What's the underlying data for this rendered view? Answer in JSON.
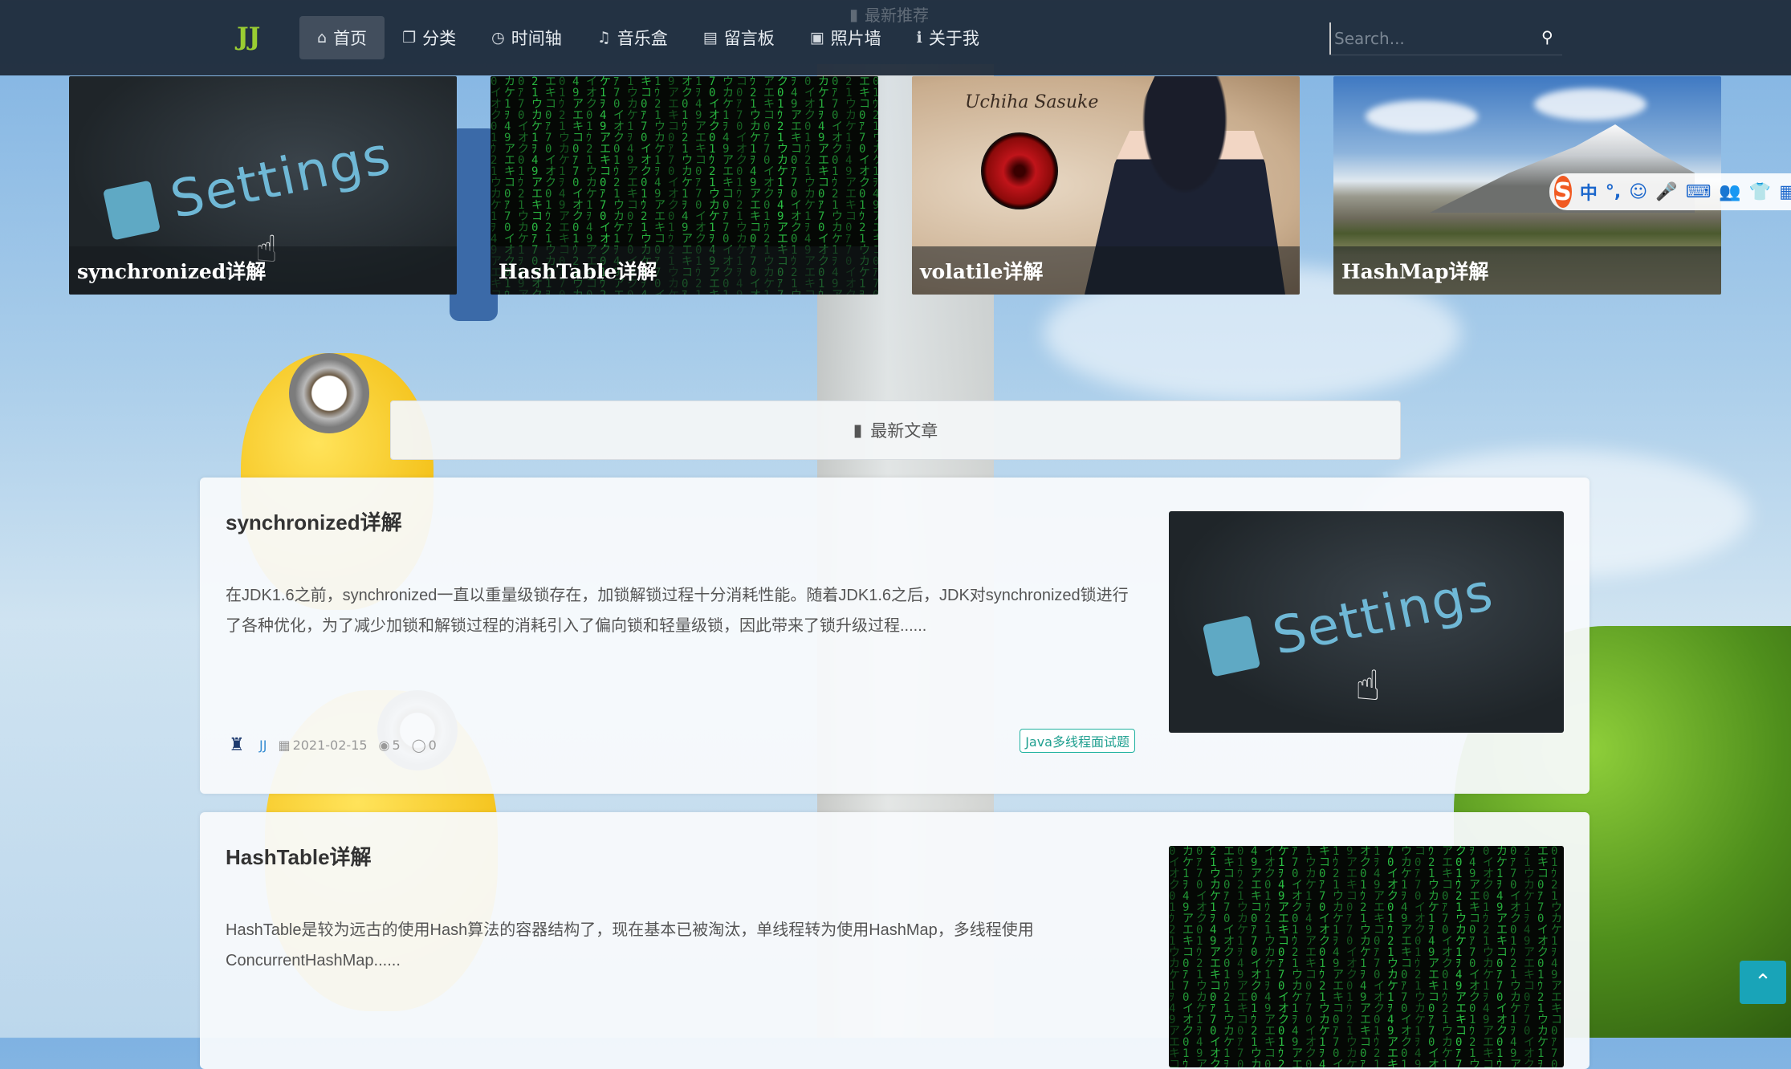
{
  "navbar": {
    "faded_header": "最新推荐",
    "brand": "JJ",
    "items": [
      {
        "label": "首页",
        "icon": "home-icon",
        "active": true
      },
      {
        "label": "分类",
        "icon": "copy-icon"
      },
      {
        "label": "时间轴",
        "icon": "clock-icon"
      },
      {
        "label": "音乐盒",
        "icon": "music-icon"
      },
      {
        "label": "留言板",
        "icon": "book-icon"
      },
      {
        "label": "照片墙",
        "icon": "picture-icon"
      },
      {
        "label": "关于我",
        "icon": "info-icon"
      }
    ],
    "search_placeholder": "Search..."
  },
  "featured": [
    {
      "title": "synchronized详解",
      "image": "settings"
    },
    {
      "title": "HashTable详解",
      "image": "matrix"
    },
    {
      "title": "volatile详解",
      "image": "sasuke",
      "image_text": "Uchiha Sasuke"
    },
    {
      "title": "HashMap详解",
      "image": "mountain"
    }
  ],
  "image_text": {
    "settings": "Settings"
  },
  "ime_toolbar": {
    "logo": "S",
    "items": [
      "中",
      "°,",
      "☺",
      "🎤",
      "⌨",
      "👥",
      "👕",
      "▦"
    ]
  },
  "section": {
    "title": "最新文章",
    "icon": "bookmark-icon"
  },
  "articles": [
    {
      "title": "synchronized详解",
      "summary": "在JDK1.6之前，synchronized一直以重量级锁存在，加锁解锁过程十分消耗性能。随着JDK1.6之后，JDK对synchronized锁进行了各种优化，为了减少加锁和解锁过程的消耗引入了偏向锁和轻量级锁，因此带来了锁升级过程......",
      "author": "JJ",
      "date": "2021-02-15",
      "views": "5",
      "comments": "0",
      "tag": "Java多线程面试题",
      "image": "settings"
    },
    {
      "title": "HashTable详解",
      "summary": "HashTable是较为远古的使用Hash算法的容器结构了，现在基本已被淘汰，单线程转为使用HashMap，多线程使用ConcurrentHashMap......",
      "image": "matrix"
    }
  ],
  "colors": {
    "navbar": "#1c2837",
    "brand": "#9acd32",
    "accent": "#19a4b8",
    "tag": "#20b2a0"
  }
}
